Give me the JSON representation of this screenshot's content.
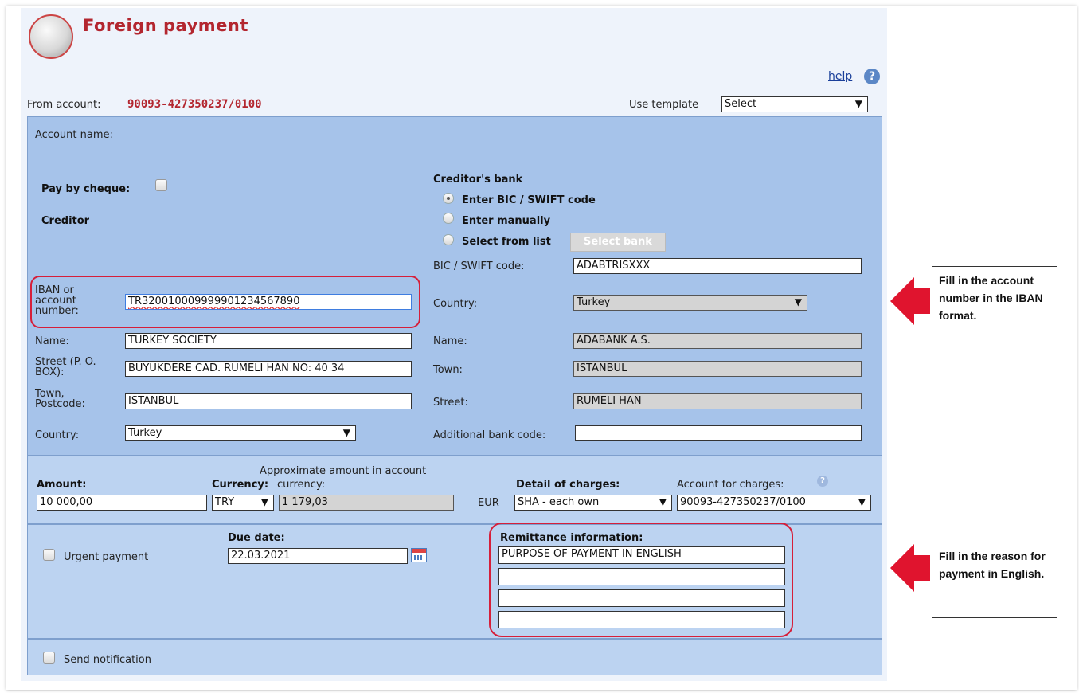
{
  "header": {
    "title": "Foreign payment",
    "help_label": "help"
  },
  "from_account": {
    "label": "From account:",
    "value": "90093-427350237/0100"
  },
  "template": {
    "label": "Use template",
    "selected": "Select"
  },
  "account_name_label": "Account name:",
  "pay_by_cheque_label": "Pay by cheque:",
  "creditor": {
    "heading": "Creditor",
    "iban_label": "IBAN or account number:",
    "iban_value": "TR320010009999901234567890",
    "name_label": "Name:",
    "name_value": "TURKEY SOCIETY",
    "street_label": "Street (P. O. BOX):",
    "street_value": "BUYUKDERE CAD. RUMELI HAN NO: 40 34",
    "town_label": "Town, Postcode:",
    "town_value": "ISTANBUL",
    "country_label": "Country:",
    "country_value": "Turkey"
  },
  "creditor_bank": {
    "heading": "Creditor's bank",
    "option_bic": "Enter BIC / SWIFT code",
    "option_manual": "Enter manually",
    "option_list": "Select from list",
    "select_bank_button": "Select bank",
    "bic_label": "BIC / SWIFT code:",
    "bic_value": "ADABTRISXXX",
    "country_label": "Country:",
    "country_value": "Turkey",
    "name_label": "Name:",
    "name_value": "ADABANK A.S.",
    "town_label": "Town:",
    "town_value": "ISTANBUL",
    "street_label": "Street:",
    "street_value": "RUMELI HAN",
    "additional_label": "Additional bank code:",
    "additional_value": ""
  },
  "amount": {
    "amount_label": "Amount:",
    "amount_value": "10 000,00",
    "currency_label": "Currency:",
    "currency_value": "TRY",
    "approx_label_line1": "Approximate amount in account",
    "approx_label_line2": "currency:",
    "approx_value": "1 179,03",
    "approx_currency": "EUR",
    "charges_label": "Detail of charges:",
    "charges_value": "SHA - each own",
    "charges_account_label": "Account for charges:",
    "charges_account_value": "90093-427350237/0100"
  },
  "payment": {
    "urgent_label": "Urgent payment",
    "due_date_label": "Due date:",
    "due_date_value": "22.03.2021",
    "remittance_label": "Remittance information:",
    "remittance_lines": [
      "PURPOSE OF PAYMENT IN ENGLISH",
      "",
      "",
      ""
    ]
  },
  "notification": {
    "label": "Send notification"
  },
  "callouts": {
    "iban": "Fill in the account number in the IBAN format.",
    "remittance": "Fill in the reason for payment in English."
  },
  "colors": {
    "title": "#b3262f",
    "panel": "#a6c3ea",
    "panel_light": "#bcd3f1",
    "highlight": "#d61f3a",
    "arrow": "#e0142e"
  }
}
